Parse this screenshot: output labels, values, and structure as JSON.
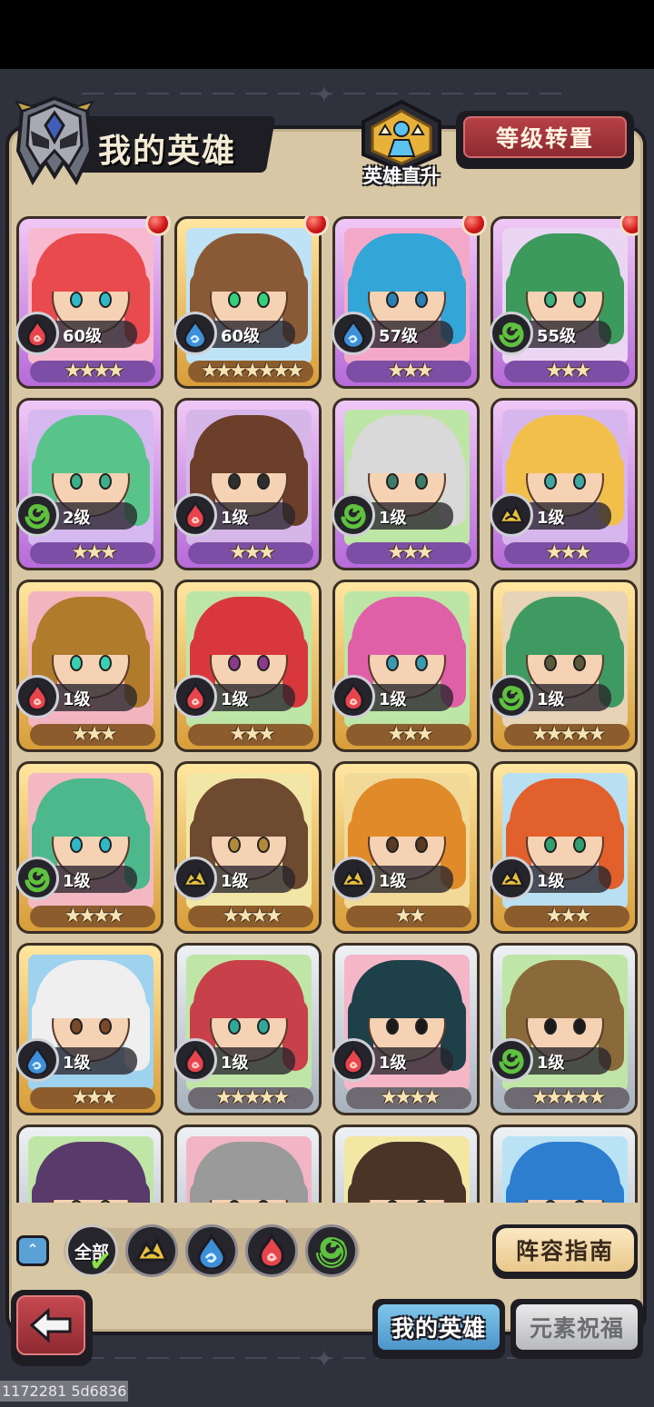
{
  "header": {
    "title": "我的英雄",
    "promote_label": "英雄直升",
    "reset_button": "等级转置"
  },
  "heroes": [
    {
      "level": "60级",
      "stars": "★★★★",
      "frame": "purple",
      "element": "fire",
      "red_dot": true,
      "hair": "#e84a4e",
      "bg": "#f7b9d0",
      "eyes": "#2fb8c8"
    },
    {
      "level": "60级",
      "stars": "★★★★★★★",
      "frame": "gold",
      "element": "water",
      "red_dot": true,
      "hair": "#8a5a36",
      "bg": "#bfe3f6",
      "eyes": "#34d07a"
    },
    {
      "level": "57级",
      "stars": "★★★",
      "frame": "purple",
      "element": "water",
      "red_dot": true,
      "hair": "#33a6d8",
      "bg": "#f4a8c8",
      "eyes": "#2b7fb2"
    },
    {
      "level": "55级",
      "stars": "★★★",
      "frame": "purple",
      "element": "wind",
      "red_dot": true,
      "hair": "#3c9a5c",
      "bg": "#ead6f2",
      "eyes": "#40b080"
    },
    {
      "level": "2级",
      "stars": "★★★",
      "frame": "purple",
      "element": "wind",
      "red_dot": false,
      "hair": "#58c48a",
      "bg": "#d5b8ef",
      "eyes": "#3bb08a"
    },
    {
      "level": "1级",
      "stars": "★★★",
      "frame": "purple",
      "element": "fire",
      "red_dot": false,
      "hair": "#6c3f2a",
      "bg": "#d6b6e9",
      "eyes": "#2e2e2e"
    },
    {
      "level": "1级",
      "stars": "★★★",
      "frame": "purple",
      "element": "wind",
      "red_dot": false,
      "hair": "#d9d9d9",
      "bg": "#bde6a6",
      "eyes": "#3e7c6a"
    },
    {
      "level": "1级",
      "stars": "★★★",
      "frame": "purple",
      "element": "earth",
      "red_dot": false,
      "hair": "#f2c04a",
      "bg": "#d7b6ee",
      "eyes": "#3fa6a0"
    },
    {
      "level": "1级",
      "stars": "★★★",
      "frame": "gold",
      "element": "fire",
      "red_dot": false,
      "hair": "#b07c2c",
      "bg": "#f2b5bf",
      "eyes": "#38d0b0"
    },
    {
      "level": "1级",
      "stars": "★★★",
      "frame": "gold",
      "element": "fire",
      "red_dot": false,
      "hair": "#d8383c",
      "bg": "#bde6a6",
      "eyes": "#8a3a8a"
    },
    {
      "level": "1级",
      "stars": "★★★",
      "frame": "gold",
      "element": "fire",
      "red_dot": false,
      "hair": "#e060a8",
      "bg": "#bde6a6",
      "eyes": "#3a9bb0"
    },
    {
      "level": "1级",
      "stars": "★★★★★",
      "frame": "gold",
      "element": "wind",
      "red_dot": false,
      "hair": "#3f9a62",
      "bg": "#e7d3b6",
      "eyes": "#5a5a3a"
    },
    {
      "level": "1级",
      "stars": "★★★★",
      "frame": "gold",
      "element": "wind",
      "red_dot": false,
      "hair": "#4cb88c",
      "bg": "#f3b8c2",
      "eyes": "#2fb8c8"
    },
    {
      "level": "1级",
      "stars": "★★★★",
      "frame": "gold",
      "element": "earth",
      "red_dot": false,
      "hair": "#6e4a30",
      "bg": "#f2e6a6",
      "eyes": "#b08a3a"
    },
    {
      "level": "1级",
      "stars": "★★",
      "frame": "gold",
      "element": "earth",
      "red_dot": false,
      "hair": "#e08a2a",
      "bg": "#f1d998",
      "eyes": "#5a3a20"
    },
    {
      "level": "1级",
      "stars": "★★★",
      "frame": "gold",
      "element": "earth",
      "red_dot": false,
      "hair": "#e2602c",
      "bg": "#b9dff2",
      "eyes": "#30a070"
    },
    {
      "level": "1级",
      "stars": "★★★",
      "frame": "gold",
      "element": "water",
      "red_dot": false,
      "hair": "#efefef",
      "bg": "#9ed2ee",
      "eyes": "#7a4a2a"
    },
    {
      "level": "1级",
      "stars": "★★★★★",
      "frame": "silver",
      "element": "fire",
      "red_dot": false,
      "hair": "#c8404a",
      "bg": "#bfe6a6",
      "eyes": "#2fa89a"
    },
    {
      "level": "1级",
      "stars": "★★★★",
      "frame": "silver",
      "element": "fire",
      "red_dot": false,
      "hair": "#1e4048",
      "bg": "#f5b6c8",
      "eyes": "#1a1a1a"
    },
    {
      "level": "1级",
      "stars": "★★★★★",
      "frame": "silver",
      "element": "wind",
      "red_dot": false,
      "hair": "#8a6a3a",
      "bg": "#bfe6a6",
      "eyes": "#1a1a1a"
    },
    {
      "level": "",
      "stars": "",
      "frame": "silver",
      "element": "none",
      "red_dot": false,
      "hair": "#5a3a6a",
      "bg": "#bfe6a6",
      "eyes": "#8a8a2a"
    },
    {
      "level": "",
      "stars": "",
      "frame": "silver",
      "element": "none",
      "red_dot": false,
      "hair": "#9a9a9a",
      "bg": "#f2b5c6",
      "eyes": "#4a4a4a"
    },
    {
      "level": "",
      "stars": "",
      "frame": "silver",
      "element": "none",
      "red_dot": false,
      "hair": "#4a3428",
      "bg": "#f3e7a4",
      "eyes": "#3a3a3a"
    },
    {
      "level": "",
      "stars": "",
      "frame": "silver",
      "element": "none",
      "red_dot": false,
      "hair": "#2e7ed0",
      "bg": "#b9e3f4",
      "eyes": "#2a6ab0"
    }
  ],
  "filters": {
    "all_label": "全部",
    "items": [
      "earth",
      "water",
      "fire",
      "wind"
    ]
  },
  "guide_button": "阵容指南",
  "tabs": [
    {
      "label": "我的英雄",
      "active": true
    },
    {
      "label": "元素祝福",
      "active": false
    }
  ],
  "build_id": "1172281 5d6836",
  "colors": {
    "fire": "#e8444c",
    "water": "#3d8fd8",
    "wind": "#5fc13e",
    "earth": "#e8c23a"
  }
}
